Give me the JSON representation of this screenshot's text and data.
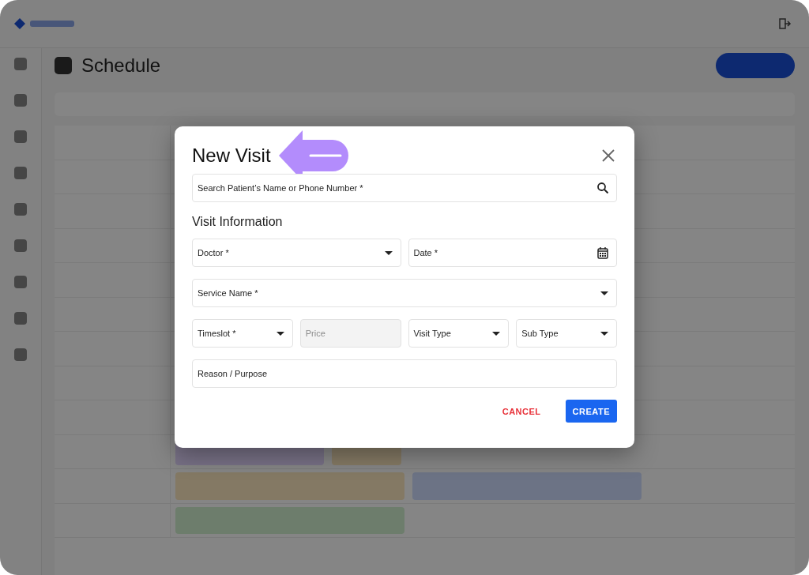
{
  "background": {
    "page_title": "Schedule"
  },
  "dialog": {
    "title": "New Visit",
    "search": {
      "placeholder": "Search Patient’s Name or Phone Number *"
    },
    "section_title": "Visit Information",
    "rows": [
      {
        "fields": [
          {
            "kind": "select",
            "placeholder": "Doctor *",
            "disabled": false
          },
          {
            "kind": "date",
            "placeholder": "Date *",
            "disabled": false
          }
        ]
      },
      {
        "fields": [
          {
            "kind": "select",
            "placeholder": "Service Name *",
            "disabled": false
          }
        ]
      },
      {
        "fields": [
          {
            "kind": "select",
            "placeholder": "Timeslot *",
            "disabled": false
          },
          {
            "kind": "text",
            "placeholder": "Price",
            "disabled": true
          },
          {
            "kind": "select",
            "placeholder": "Visit Type",
            "disabled": false
          },
          {
            "kind": "select",
            "placeholder": "Sub Type",
            "disabled": false
          }
        ]
      },
      {
        "fields": [
          {
            "kind": "text",
            "placeholder": "Reason / Purpose",
            "disabled": false
          }
        ]
      }
    ],
    "buttons": [
      {
        "kind": "text",
        "label": "CANCEL"
      },
      {
        "kind": "primary",
        "label": "CREATE"
      }
    ]
  }
}
